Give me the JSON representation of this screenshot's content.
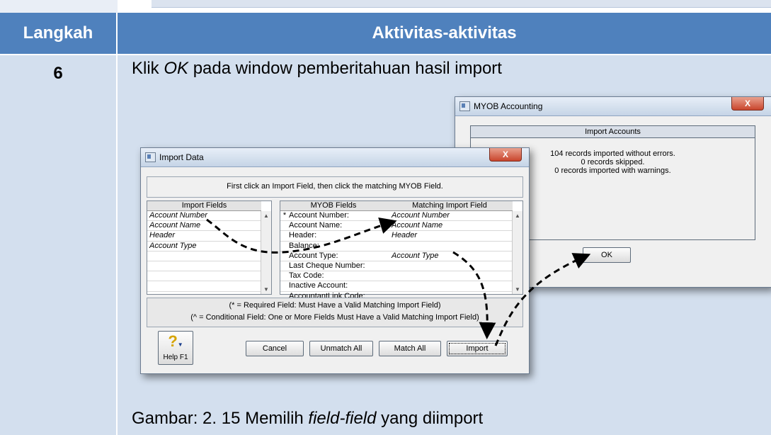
{
  "table": {
    "header_step": "Langkah",
    "header_activity": "Aktivitas-aktivitas",
    "step_number": "6",
    "instruction_pre": "Klik ",
    "instruction_italic": "OK",
    "instruction_post": " pada window pemberitahuan hasil import",
    "caption_pre": "Gambar: 2. 15 Memilih ",
    "caption_italic": "field-field",
    "caption_post": " yang diimport",
    "header_color": "#4f81bd",
    "row_color": "#d3dfee"
  },
  "myob_window": {
    "title": "MYOB Accounting",
    "close_label": "X",
    "panel_title": "Import Accounts",
    "messages": [
      "104 records imported without errors.",
      "0 records skipped.",
      "0 records imported with warnings."
    ],
    "ok_label": "OK"
  },
  "import_window": {
    "title": "Import Data",
    "close_label": "X",
    "instruction": "First click an Import Field, then click the matching MYOB Field.",
    "import_fields_header": "Import Fields",
    "import_fields": [
      "Account Number",
      "Account Name",
      "Header",
      "Account Type",
      "",
      "",
      "",
      "",
      ""
    ],
    "myob_fields_header": "MYOB Fields",
    "matching_header": "Matching Import Field",
    "myob_rows": [
      {
        "marker": "*",
        "field": "Account Number:",
        "match": "Account Number"
      },
      {
        "marker": "",
        "field": "Account Name:",
        "match": "Account Name"
      },
      {
        "marker": "",
        "field": "Header:",
        "match": "Header"
      },
      {
        "marker": "",
        "field": "Balance:",
        "match": ""
      },
      {
        "marker": "",
        "field": "Account Type:",
        "match": "Account Type"
      },
      {
        "marker": "",
        "field": "Last Cheque Number:",
        "match": ""
      },
      {
        "marker": "",
        "field": "Tax Code:",
        "match": ""
      },
      {
        "marker": "",
        "field": "Inactive Account:",
        "match": ""
      },
      {
        "marker": "",
        "field": "AccountantLink Code:",
        "match": ""
      }
    ],
    "note_required": "(* = Required Field:  Must Have a Valid Matching Import Field)",
    "note_conditional": "(^ = Conditional Field:  One or More Fields Must Have a Valid Matching Import Field)",
    "help_label": "Help F1",
    "buttons": {
      "cancel": "Cancel",
      "unmatch_all": "Unmatch All",
      "match_all": "Match All",
      "import": "Import"
    }
  }
}
